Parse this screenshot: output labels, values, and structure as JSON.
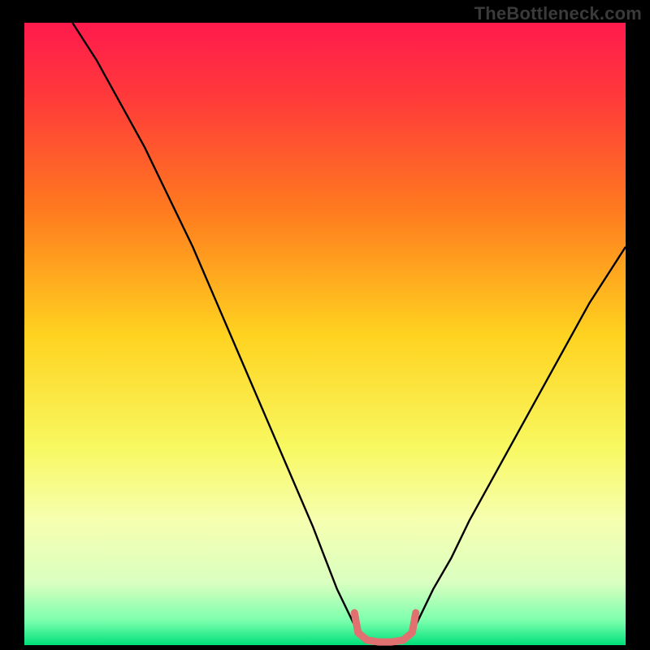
{
  "watermark": "TheBottleneck.com",
  "colors": {
    "black": "#000000",
    "curve": "#000000",
    "accent": "#e17070",
    "gradient_stops": [
      {
        "offset": 0.0,
        "color": "#ff1a4d"
      },
      {
        "offset": 0.12,
        "color": "#ff3a3a"
      },
      {
        "offset": 0.3,
        "color": "#ff7a1f"
      },
      {
        "offset": 0.5,
        "color": "#ffd21f"
      },
      {
        "offset": 0.68,
        "color": "#f8f860"
      },
      {
        "offset": 0.8,
        "color": "#f6ffb0"
      },
      {
        "offset": 0.9,
        "color": "#d9ffc0"
      },
      {
        "offset": 0.96,
        "color": "#7dffad"
      },
      {
        "offset": 1.0,
        "color": "#00e07a"
      }
    ]
  },
  "chart_data": {
    "type": "line",
    "title": "",
    "xlabel": "",
    "ylabel": "",
    "xlim": [
      0,
      100
    ],
    "ylim": [
      0,
      100
    ],
    "series": [
      {
        "name": "left-arm",
        "x": [
          8,
          12,
          16,
          20,
          24,
          28,
          32,
          36,
          40,
          44,
          48,
          50,
          52,
          54,
          55.5
        ],
        "y": [
          100,
          94,
          87,
          80,
          72,
          64,
          55,
          46,
          37,
          28,
          19,
          14,
          9,
          5,
          2
        ]
      },
      {
        "name": "right-arm",
        "x": [
          64.5,
          66,
          68,
          71,
          74,
          78,
          82,
          86,
          90,
          94,
          98,
          100
        ],
        "y": [
          2,
          5,
          9,
          14,
          20,
          27,
          34,
          41,
          48,
          55,
          61,
          64
        ]
      },
      {
        "name": "valley-floor",
        "x": [
          55.5,
          57,
          59,
          61,
          63,
          64.5
        ],
        "y": [
          2,
          0.8,
          0.5,
          0.5,
          0.8,
          2
        ]
      }
    ],
    "accent_segment": {
      "name": "valley-highlight",
      "x": [
        55.5,
        57,
        59,
        61,
        63,
        64.5
      ],
      "y": [
        2,
        0.8,
        0.5,
        0.5,
        0.8,
        2
      ]
    }
  }
}
